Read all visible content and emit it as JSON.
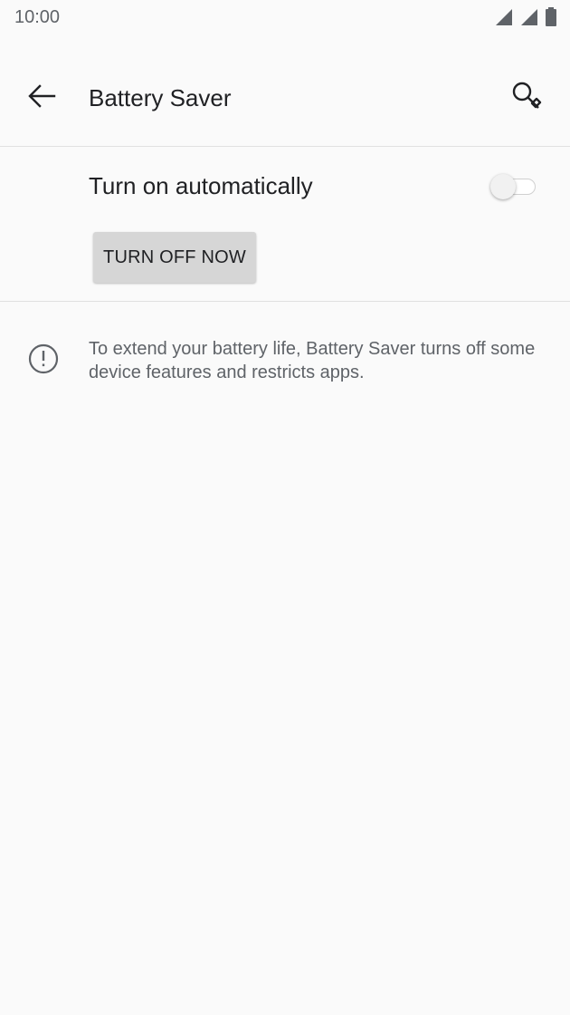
{
  "status_bar": {
    "time": "10:00",
    "icons": [
      "signal-icon",
      "signal-icon",
      "battery-icon"
    ]
  },
  "toolbar": {
    "title": "Battery Saver",
    "back_icon": "arrow-left-icon",
    "search_icon": "search-icon"
  },
  "settings": {
    "auto_label": "Turn on automatically",
    "auto_enabled": false
  },
  "actions": {
    "turn_off_label": "TURN OFF NOW"
  },
  "footer": {
    "info_icon": "info-icon",
    "text": "To extend your battery life, Battery Saver turns off some device features and restricts apps."
  },
  "colors": {
    "background": "#fafafa",
    "primary_text": "#202124",
    "secondary_text": "#5f6368",
    "button_bg": "#d6d6d6",
    "divider": "#e0e0e0"
  }
}
